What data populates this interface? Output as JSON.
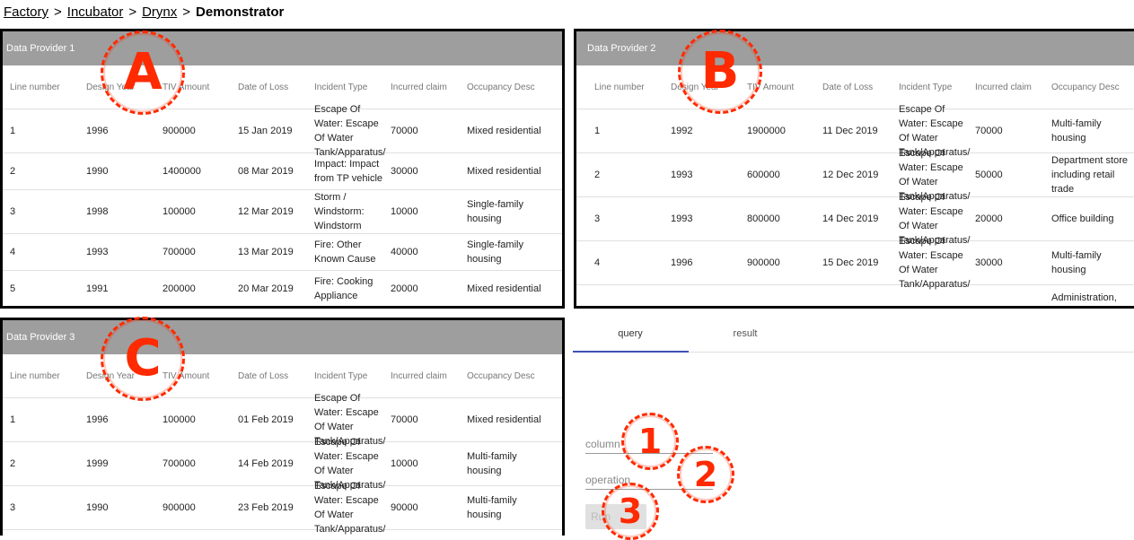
{
  "breadcrumb": {
    "items": [
      "Factory",
      "Incubator",
      "Drynx"
    ],
    "current": "Demonstrator",
    "separator": ">"
  },
  "columns": [
    "Line number",
    "Design Year",
    "TIV Amount",
    "Date of Loss",
    "Incident Type",
    "Incurred claim",
    "Occupancy Desc"
  ],
  "providers": [
    {
      "title": "Data Provider 1",
      "rows": [
        [
          "1",
          "1996",
          "900000",
          "15 Jan 2019",
          "Escape Of Water: Escape Of Water Tank/Apparatus/",
          "70000",
          "Mixed residential"
        ],
        [
          "2",
          "1990",
          "1400000",
          "08 Mar 2019",
          "Impact: Impact from TP vehicle",
          "30000",
          "Mixed residential"
        ],
        [
          "3",
          "1998",
          "100000",
          "12 Mar 2019",
          "Storm / Windstorm: Windstorm",
          "10000",
          "Single-family housing"
        ],
        [
          "4",
          "1993",
          "700000",
          "13 Mar 2019",
          "Fire: Other Known Cause",
          "40000",
          "Single-family housing"
        ],
        [
          "5",
          "1991",
          "200000",
          "20 Mar 2019",
          "Fire: Cooking Appliance",
          "20000",
          "Mixed residential"
        ]
      ]
    },
    {
      "title": "Data Provider 2",
      "rows": [
        [
          "1",
          "1992",
          "1900000",
          "11 Dec 2019",
          "Escape Of Water: Escape Of Water Tank/Apparatus/",
          "70000",
          "Multi-family housing"
        ],
        [
          "2",
          "1993",
          "600000",
          "12 Dec 2019",
          "Escape Of Water: Escape Of Water Tank/Apparatus/",
          "50000",
          "Department store including retail trade"
        ],
        [
          "3",
          "1993",
          "800000",
          "14 Dec 2019",
          "Escape Of Water: Escape Of Water Tank/Apparatus/",
          "20000",
          "Office building"
        ],
        [
          "4",
          "1996",
          "900000",
          "15 Dec 2019",
          "Escape Of Water: Escape Of Water Tank/Apparatus/",
          "30000",
          "Multi-family housing"
        ],
        [
          "",
          "",
          "",
          "",
          "",
          "",
          "Administration, commercial"
        ]
      ]
    },
    {
      "title": "Data Provider 3",
      "rows": [
        [
          "1",
          "1996",
          "100000",
          "01 Feb 2019",
          "Escape Of Water: Escape Of Water Tank/Apparatus/",
          "70000",
          "Mixed residential"
        ],
        [
          "2",
          "1999",
          "700000",
          "14 Feb 2019",
          "Escape Of Water: Escape Of Water Tank/Apparatus/",
          "10000",
          "Multi-family housing"
        ],
        [
          "3",
          "1990",
          "900000",
          "23 Feb 2019",
          "Escape Of Water: Escape Of Water Tank/Apparatus/",
          "90000",
          "Multi-family housing"
        ]
      ]
    }
  ],
  "query_panel": {
    "tabs": [
      "query",
      "result"
    ],
    "active_tab": "query",
    "column_placeholder": "column",
    "operation_placeholder": "operation",
    "run_label": "Run"
  },
  "annotations": [
    "A",
    "B",
    "C",
    "1",
    "2",
    "3"
  ],
  "colors": {
    "accent": "#3f51b5",
    "annotation": "#ff2a00",
    "panel_header": "#9e9e9e"
  }
}
